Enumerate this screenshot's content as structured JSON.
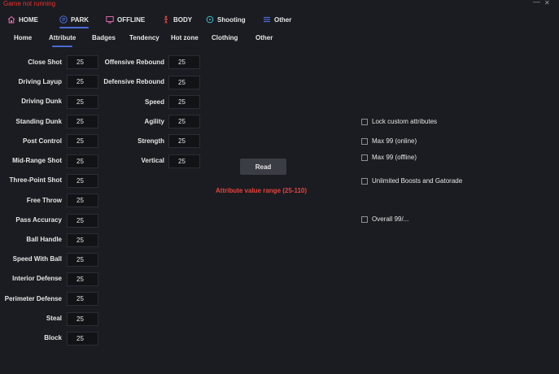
{
  "window": {
    "title": "Game not running",
    "minimize_glyph": "—",
    "close_glyph": "✕"
  },
  "topnav": [
    {
      "label": "HOME",
      "icon": "home-icon"
    },
    {
      "label": "PARK",
      "icon": "park-p-icon",
      "active": true
    },
    {
      "label": "OFFLINE",
      "icon": "monitor-icon"
    },
    {
      "label": "BODY",
      "icon": "person-icon"
    },
    {
      "label": "Shooting",
      "icon": "crosshair-icon"
    },
    {
      "label": "Other",
      "icon": "list-icon"
    }
  ],
  "subnav": [
    {
      "label": "Home"
    },
    {
      "label": "Attribute",
      "active": true
    },
    {
      "label": "Badges"
    },
    {
      "label": "Tendency"
    },
    {
      "label": "Hot zone"
    },
    {
      "label": "Clothing"
    },
    {
      "label": "Other"
    }
  ],
  "attributes_left": [
    {
      "label": "Close Shot",
      "value": "25"
    },
    {
      "label": "Driving Layup",
      "value": "25"
    },
    {
      "label": "Driving Dunk",
      "value": "25"
    },
    {
      "label": "Standing Dunk",
      "value": "25"
    },
    {
      "label": "Post Control",
      "value": "25"
    },
    {
      "label": "Mid-Range Shot",
      "value": "25"
    },
    {
      "label": "Three-Point Shot",
      "value": "25"
    },
    {
      "label": "Free Throw",
      "value": "25"
    },
    {
      "label": "Pass Accuracy",
      "value": "25"
    },
    {
      "label": "Ball Handle",
      "value": "25"
    },
    {
      "label": "Speed With Ball",
      "value": "25"
    },
    {
      "label": "Interior Defense",
      "value": "25"
    },
    {
      "label": "Perimeter Defense",
      "value": "25"
    },
    {
      "label": "Steal",
      "value": "25"
    },
    {
      "label": "Block",
      "value": "25"
    }
  ],
  "attributes_right": [
    {
      "label": "Offensive Rebound",
      "value": "25"
    },
    {
      "label": "Defensive Rebound",
      "value": "25"
    },
    {
      "label": "Speed",
      "value": "25"
    },
    {
      "label": "Agility",
      "value": "25"
    },
    {
      "label": "Strength",
      "value": "25"
    },
    {
      "label": "Vertical",
      "value": "25"
    }
  ],
  "read_button": "Read",
  "range_note": "Attribute value range (25-110)",
  "options": [
    {
      "label": "Lock custom attributes",
      "checked": false
    },
    {
      "label": "Max 99 (online)",
      "checked": false
    },
    {
      "label": "Max 99 (offline)",
      "checked": false
    },
    {
      "label": "Unlimited Boosts and Gatorade",
      "checked": false
    },
    {
      "label": "Overall 99/...",
      "checked": false
    }
  ],
  "colors": {
    "background": "#1a1c21",
    "accent": "#4b6bd6",
    "warning": "#e8332f",
    "input_bg": "#111317",
    "button_bg": "#3a3d44"
  }
}
